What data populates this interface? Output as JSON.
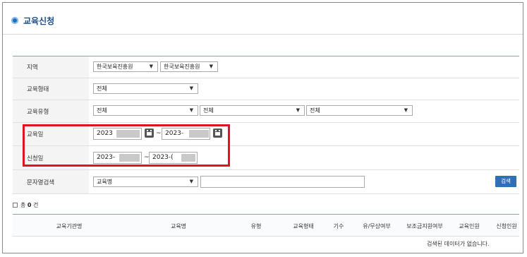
{
  "page": {
    "title": "교육신청"
  },
  "form": {
    "region": {
      "label": "지역",
      "select1": "한국보육진흥원",
      "select2": "한국보육진흥원"
    },
    "edu_form": {
      "label": "교육형태",
      "select": "전체"
    },
    "edu_type": {
      "label": "교육유형",
      "select1": "전체",
      "select2": "전체",
      "select3": "전체"
    },
    "edu_date": {
      "label": "교육일",
      "from": "2023",
      "to": "2023-"
    },
    "apply_date": {
      "label": "신청일",
      "from": "2023-",
      "to": "2023-("
    },
    "text_search": {
      "label": "문자열검색",
      "select": "교육명",
      "value": ""
    },
    "search_button": "검색"
  },
  "result": {
    "total_prefix": "총",
    "total_count": "0",
    "total_suffix": "건"
  },
  "table": {
    "columns": [
      "교육기관명",
      "교육명",
      "유형",
      "교육형태",
      "기수",
      "유/무상여부",
      "보조금지원여부",
      "교육인원",
      "신청인원"
    ],
    "empty_message": "검색된 데이터가 없습니다."
  },
  "colors": {
    "highlight": "#e0141e",
    "accent": "#2f6fb6",
    "title": "#1e4f8a"
  }
}
